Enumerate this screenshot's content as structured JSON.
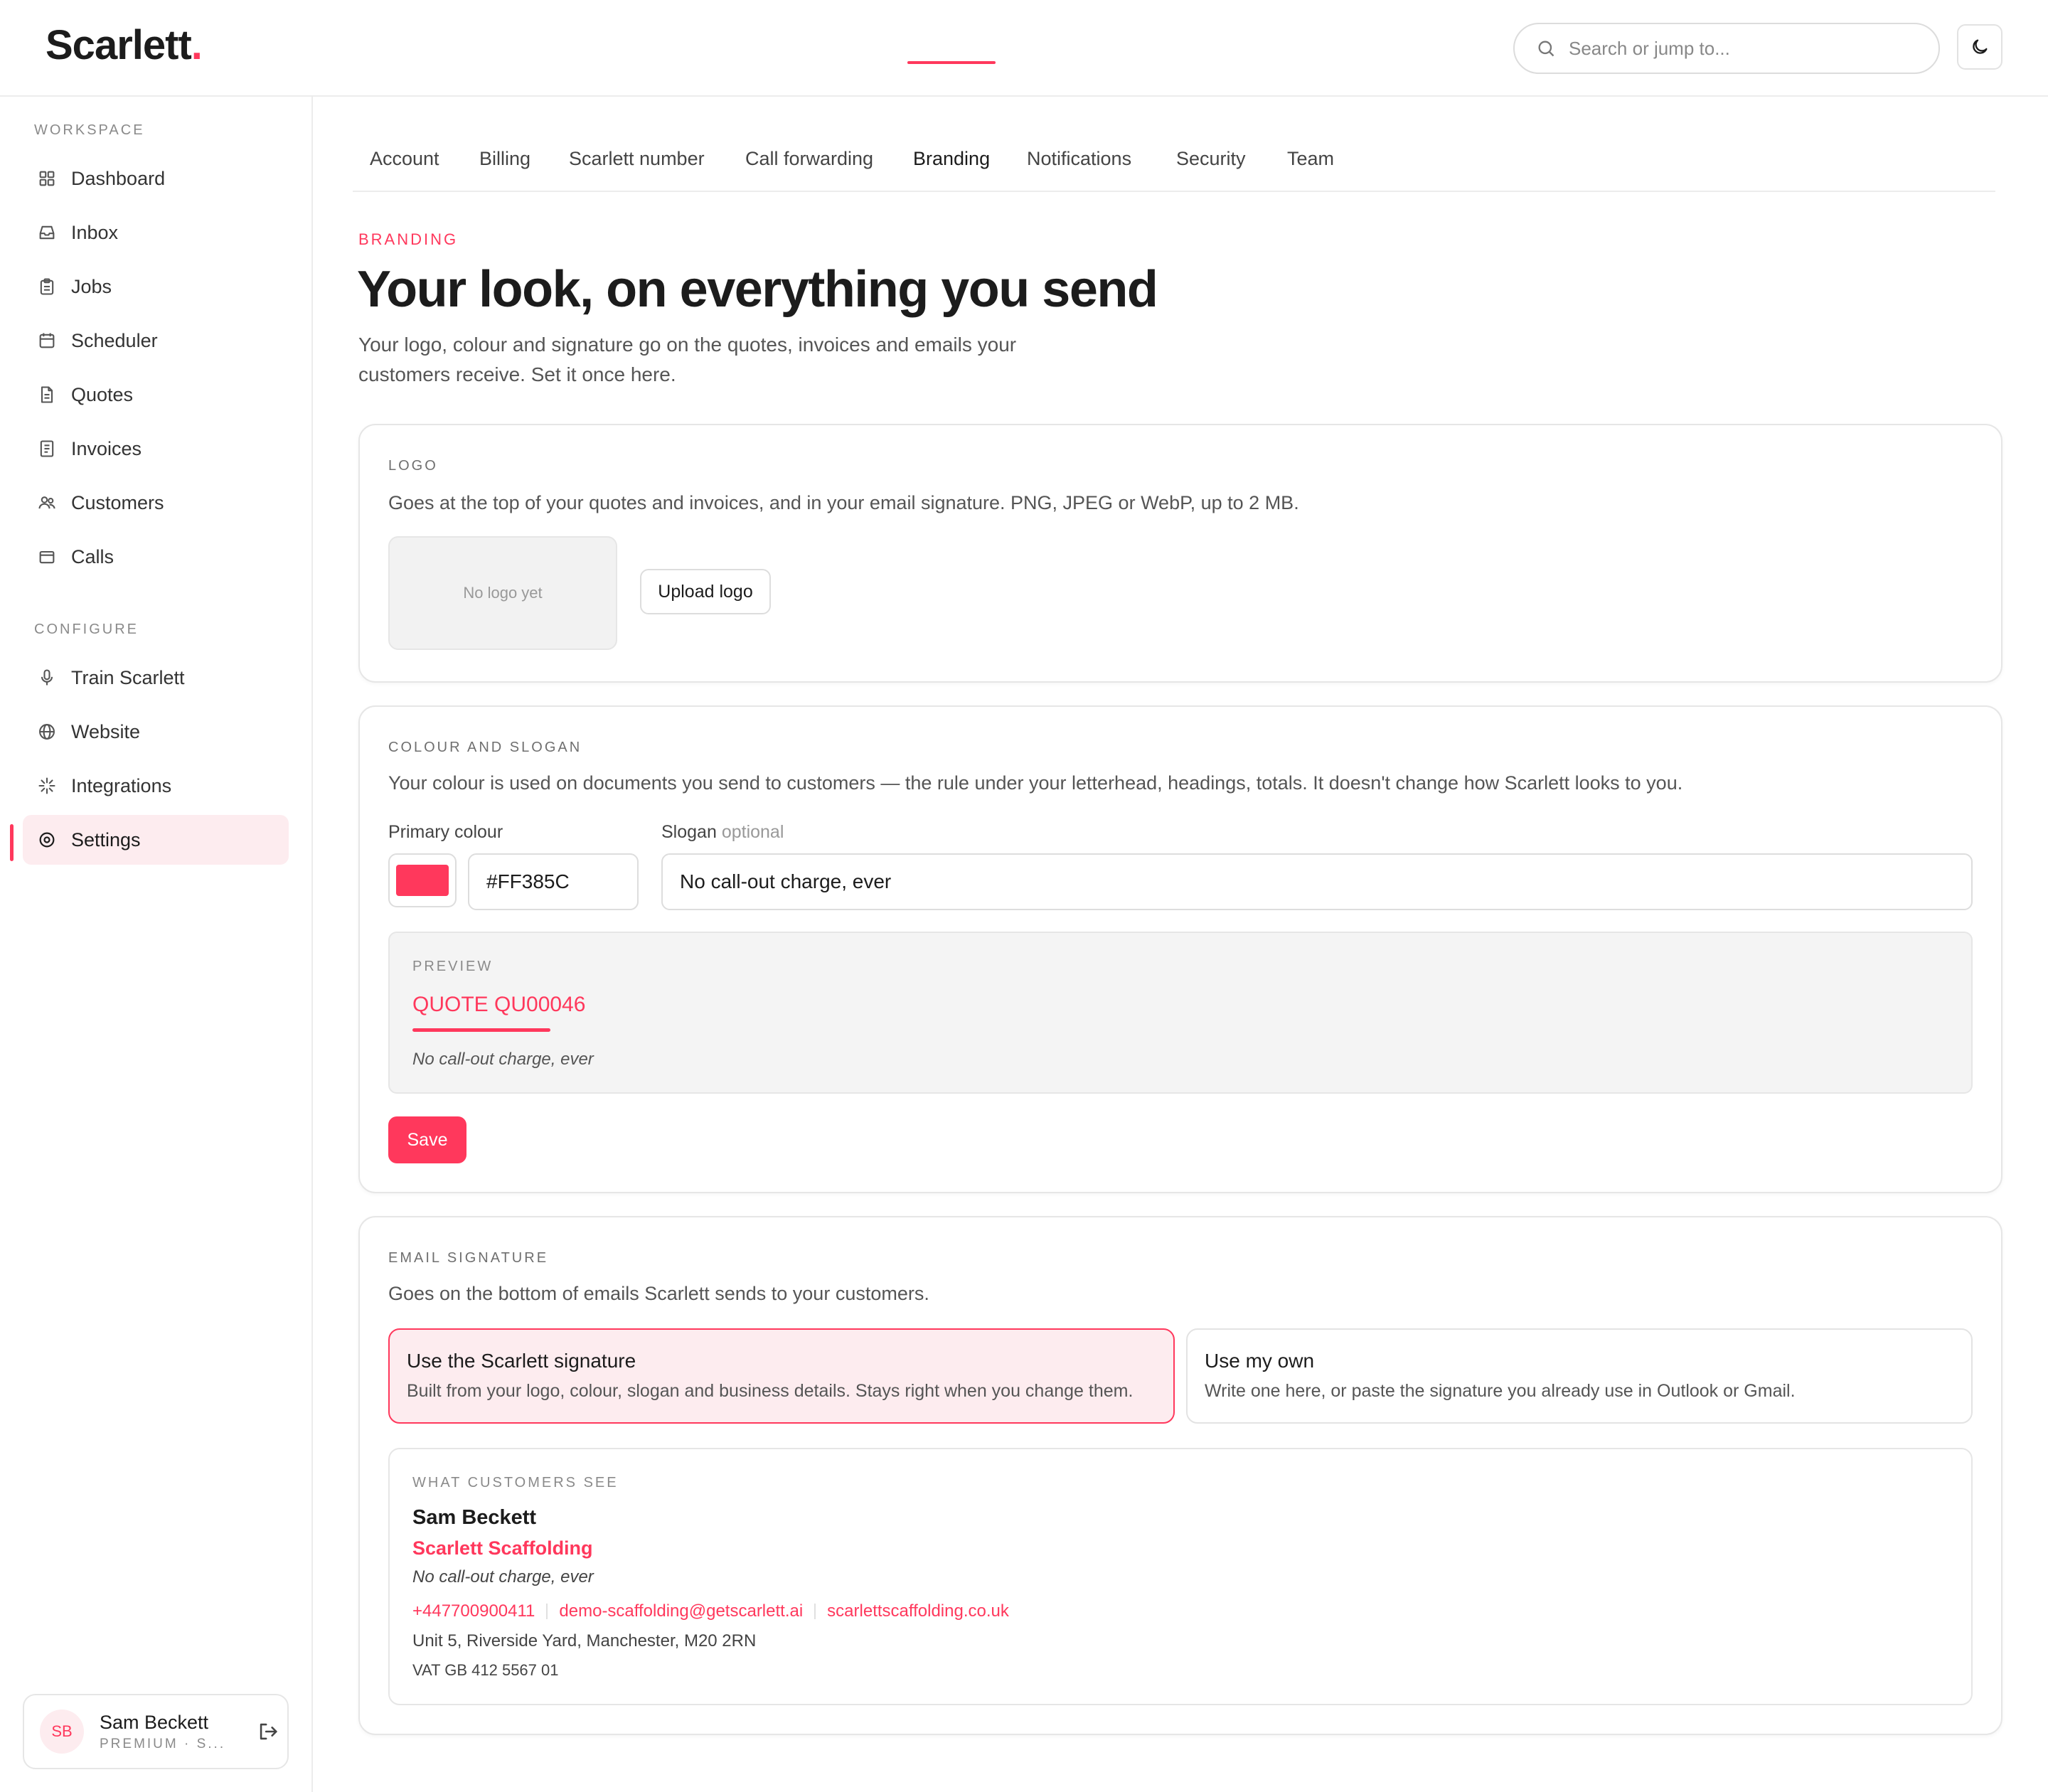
{
  "app": {
    "brand_name": "Scarlett",
    "brand_dot": ".",
    "accent": "#ff385c"
  },
  "header": {
    "search_placeholder": "Search or jump to...",
    "search_icon": "search-icon",
    "theme_icon": "moon-icon"
  },
  "sidebar": {
    "workspace_label": "WORKSPACE",
    "configure_label": "CONFIGURE",
    "workspace_items": [
      {
        "label": "Dashboard",
        "icon": "grid-icon"
      },
      {
        "label": "Inbox",
        "icon": "inbox-icon"
      },
      {
        "label": "Jobs",
        "icon": "clipboard-icon"
      },
      {
        "label": "Scheduler",
        "icon": "calendar-icon"
      },
      {
        "label": "Quotes",
        "icon": "document-icon"
      },
      {
        "label": "Invoices",
        "icon": "receipt-icon"
      },
      {
        "label": "Customers",
        "icon": "users-icon"
      },
      {
        "label": "Calls",
        "icon": "phone-icon"
      }
    ],
    "configure_items": [
      {
        "label": "Train Scarlett",
        "icon": "microphone-icon"
      },
      {
        "label": "Website",
        "icon": "globe-icon"
      },
      {
        "label": "Integrations",
        "icon": "sparkle-icon"
      },
      {
        "label": "Settings",
        "icon": "gear-icon",
        "active": true
      }
    ],
    "user": {
      "initials": "SB",
      "name": "Sam Beckett",
      "plan": "PREMIUM · S...",
      "logout_icon": "logout-icon"
    }
  },
  "tabs": [
    {
      "label": "Account"
    },
    {
      "label": "Billing"
    },
    {
      "label": "Scarlett number"
    },
    {
      "label": "Call forwarding"
    },
    {
      "label": "Branding",
      "active": true
    },
    {
      "label": "Notifications"
    },
    {
      "label": "Security"
    },
    {
      "label": "Team"
    }
  ],
  "page": {
    "eyebrow": "BRANDING",
    "title": "Your look, on everything you send",
    "subtitle": "Your logo, colour and signature go on the quotes, invoices and emails your customers receive. Set it once here."
  },
  "logo_card": {
    "title": "LOGO",
    "description": "Goes at the top of your quotes and invoices, and in your email signature. PNG, JPEG or WebP, up to 2 MB.",
    "placeholder": "No logo yet",
    "upload_label": "Upload logo"
  },
  "colour_card": {
    "title": "COLOUR AND SLOGAN",
    "description": "Your colour is used on documents you send to customers — the rule under your letterhead, headings, totals. It doesn't change how Scarlett looks to you.",
    "primary_label": "Primary colour",
    "primary_value": "#FF385C",
    "swatch_color": "#ff385c",
    "slogan_label": "Slogan",
    "slogan_optional": "optional",
    "slogan_value": "No call-out charge, ever",
    "preview_label": "PREVIEW",
    "preview_quote": "QUOTE QU00046",
    "preview_slogan": "No call-out charge, ever",
    "save_label": "Save"
  },
  "signature_card": {
    "title": "EMAIL SIGNATURE",
    "description": "Goes on the bottom of emails Scarlett sends to your customers.",
    "options": [
      {
        "title": "Use the Scarlett signature",
        "desc": "Built from your logo, colour, slogan and business details. Stays right when you change them.",
        "selected": true
      },
      {
        "title": "Use my own",
        "desc": "Write one here, or paste the signature you already use in Outlook or Gmail.",
        "selected": false
      }
    ],
    "preview_label": "WHAT CUSTOMERS SEE",
    "name": "Sam Beckett",
    "company": "Scarlett Scaffolding",
    "slogan": "No call-out charge, ever",
    "phone": "+447700900411",
    "email": "demo-scaffolding@getscarlett.ai",
    "website": "scarlettscaffolding.co.uk",
    "address": "Unit 5, Riverside Yard, Manchester, M20 2RN",
    "vat": "VAT GB 412 5567 01"
  }
}
